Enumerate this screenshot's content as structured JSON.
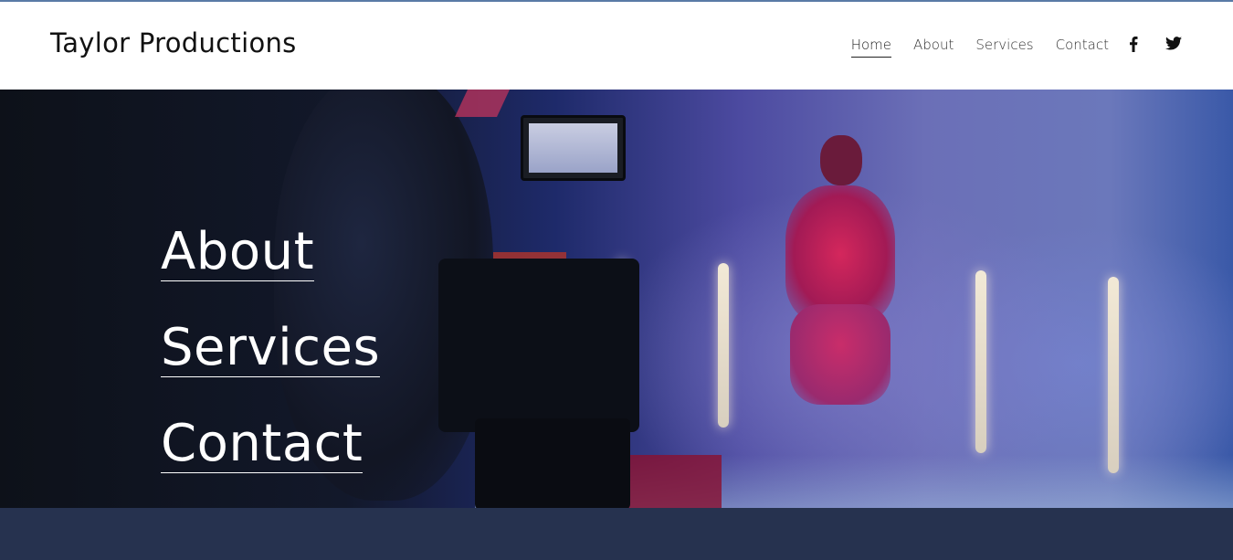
{
  "brand": {
    "name": "Taylor Productions"
  },
  "nav": {
    "items": [
      {
        "label": "Home",
        "active": true
      },
      {
        "label": "About",
        "active": false
      },
      {
        "label": "Services",
        "active": false
      },
      {
        "label": "Contact",
        "active": false
      }
    ],
    "social": [
      {
        "icon": "facebook-icon"
      },
      {
        "icon": "twitter-icon"
      }
    ]
  },
  "hero": {
    "links": [
      {
        "label": "About"
      },
      {
        "label": "Services"
      },
      {
        "label": "Contact"
      }
    ]
  },
  "colors": {
    "header_bg": "#ffffff",
    "hero_text": "#ffffff",
    "footer_band": "#26324f",
    "top_accent": "#5a7aa6"
  }
}
